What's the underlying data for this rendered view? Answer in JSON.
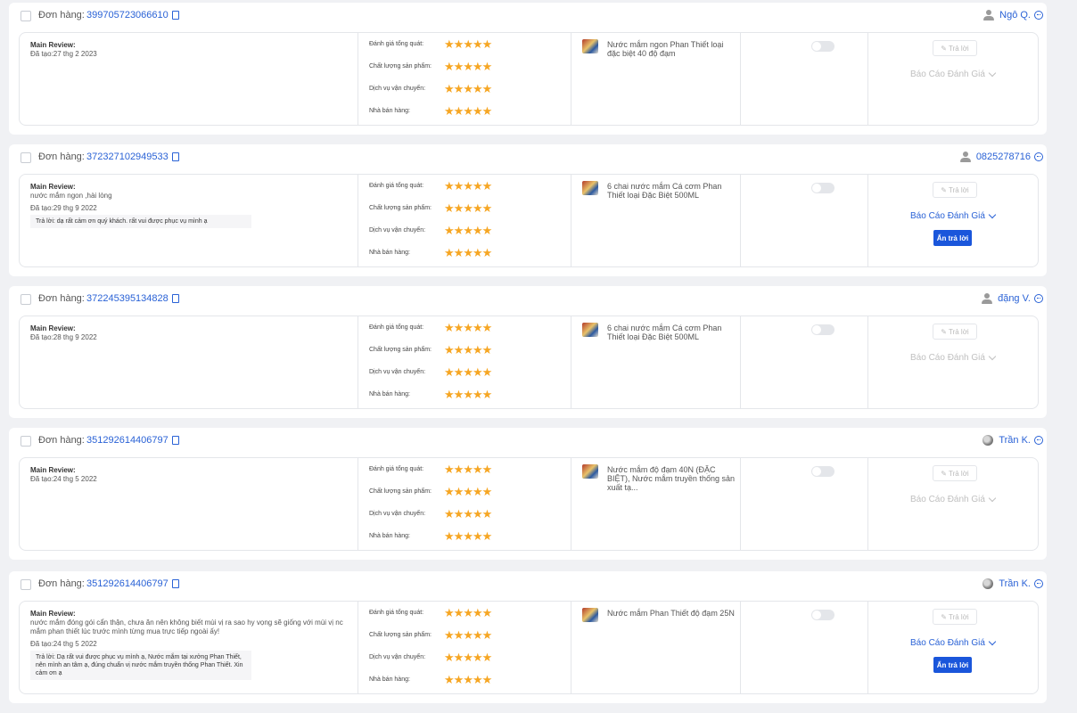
{
  "labels": {
    "order": "Đơn hàng:",
    "main_review": "Main Review:",
    "rating_overall": "Đánh giá tổng quát:",
    "rating_quality": "Chất lượng sản phẩm:",
    "rating_shipping": "Dịch vụ vận chuyển:",
    "rating_seller": "Nhà bán hàng:",
    "reply_button": "Trả lời",
    "report": "Báo Cáo Đánh Giá",
    "hide_reply": "Ẩn trả lời"
  },
  "colors": {
    "accent": "#2a62d6",
    "star": "#f6a623",
    "primary_button": "#1a56db"
  },
  "reviews": [
    {
      "order_id": "399705723066610",
      "buyer": "Ngô Q.",
      "avatar": "person-icon",
      "text": "",
      "created": "Đã tạo:27 thg 2 2023",
      "reply": "",
      "ratings": {
        "overall": 5,
        "quality": 5,
        "shipping": 5,
        "seller": 5
      },
      "product": "Nước mắm ngon Phan Thiết loại đặc biệt 40 độ đạm",
      "toggle_on": false,
      "report_active": false
    },
    {
      "order_id": "372327102949533",
      "buyer": "0825278716",
      "avatar": "person-icon",
      "text": "nước mắm ngon ,hài lòng",
      "created": "Đã tạo:29 thg 9 2022",
      "reply": "Trả lời: dạ rất cảm ơn quý khách. rất vui được phục vụ mình ạ",
      "ratings": {
        "overall": 5,
        "quality": 5,
        "shipping": 5,
        "seller": 5
      },
      "product": "6 chai nước mắm Cá cơm Phan Thiết loại Đặc Biệt 500ML",
      "toggle_on": false,
      "report_active": true
    },
    {
      "order_id": "372245395134828",
      "buyer": "đặng V.",
      "avatar": "person-icon",
      "text": "",
      "created": "Đã tạo:28 thg 9 2022",
      "reply": "",
      "ratings": {
        "overall": 5,
        "quality": 5,
        "shipping": 5,
        "seller": 5
      },
      "product": "6 chai nước mắm Cá cơm Phan Thiết loại Đặc Biệt 500ML",
      "toggle_on": false,
      "report_active": false
    },
    {
      "order_id": "351292614406797",
      "buyer": "Trần K.",
      "avatar": "photo-avatar",
      "text": "",
      "created": "Đã tạo:24 thg 5 2022",
      "reply": "",
      "ratings": {
        "overall": 5,
        "quality": 5,
        "shipping": 5,
        "seller": 5
      },
      "product": "Nước mắm độ đạm 40N (ĐẶC BIỆT), Nước mắm truyền thống sản xuất tạ...",
      "toggle_on": false,
      "report_active": false
    },
    {
      "order_id": "351292614406797",
      "buyer": "Trần K.",
      "avatar": "photo-avatar",
      "text": "nước mắm đóng gói cẩn thận, chưa ăn nên không biết mùi vị ra sao hy vọng sẽ giống với mùi vị nc mắm phan thiết lúc trước mình từng mua trực tiếp ngoài ấy!",
      "created": "Đã tạo:24 thg 5 2022",
      "reply": "Trả lời: Dạ rất vui được phục vụ mình ạ, Nước mắm tại xưởng Phan Thiết, nên mình an tâm ạ, đúng chuẩn vị nước mắm truyền thống Phan Thiết. Xin cảm ơn ạ",
      "ratings": {
        "overall": 5,
        "quality": 5,
        "shipping": 5,
        "seller": 5
      },
      "product": "Nước mắm Phan Thiết độ đạm 25N",
      "toggle_on": false,
      "report_active": true
    }
  ]
}
